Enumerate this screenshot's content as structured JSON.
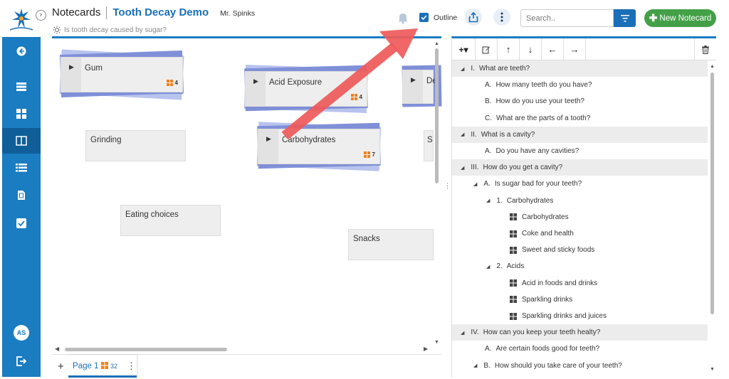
{
  "header": {
    "app_name": "Notecards",
    "project_name": "Tooth Decay Demo",
    "teacher": "Mr. Spinks",
    "question": "Is tooth decay caused by sugar?",
    "outline_label": "Outline",
    "outline_checked": true,
    "search_placeholder": "Search..",
    "new_button_label": "New Notecard"
  },
  "sidebar": {
    "items": [
      {
        "icon": "back-arrow-icon"
      },
      {
        "icon": "stack-icon"
      },
      {
        "icon": "grid-icon"
      },
      {
        "icon": "columns-icon",
        "active": true
      },
      {
        "icon": "list-icon"
      },
      {
        "icon": "document-icon"
      },
      {
        "icon": "checkbox-icon"
      }
    ],
    "avatar_initials": "AS",
    "logout_icon": "logout-icon"
  },
  "cards": [
    {
      "title": "Gum",
      "stacked": true,
      "count": "4"
    },
    {
      "title": "Acid Exposure",
      "stacked": true,
      "count": "4"
    },
    {
      "title": "De",
      "stacked": true,
      "count": ""
    },
    {
      "title": "Grinding",
      "stacked": false
    },
    {
      "title": "Carbohydrates",
      "stacked": true,
      "count": "7"
    },
    {
      "title": "S",
      "stacked": false
    },
    {
      "title": "Eating choices",
      "stacked": false
    },
    {
      "title": "Snacks",
      "stacked": false
    }
  ],
  "page_bar": {
    "add_label": "+",
    "page_name": "Page 1",
    "page_count": "32",
    "menu_label": "⋮"
  },
  "outline": {
    "toolbar": [
      "+▾",
      "edit-icon",
      "↑",
      "↓",
      "←",
      "→"
    ],
    "rows": [
      {
        "label": "I.",
        "text": "What are teeth?",
        "level": 0,
        "shaded": true,
        "expand": true
      },
      {
        "label": "A.",
        "text": "How many teeth do you have?",
        "level": 1
      },
      {
        "label": "B.",
        "text": "How do you use your teeth?",
        "level": 1
      },
      {
        "label": "C.",
        "text": "What are the parts of a tooth?",
        "level": 1
      },
      {
        "label": "II.",
        "text": "What is a cavity?",
        "level": 0,
        "shaded": true,
        "expand": true
      },
      {
        "label": "A.",
        "text": "Do you have any cavities?",
        "level": 1
      },
      {
        "label": "III.",
        "text": "How do you get a cavity?",
        "level": 0,
        "shaded": true,
        "expand": true
      },
      {
        "label": "A.",
        "text": "Is sugar bad for your teeth?",
        "level": 1,
        "expand": true
      },
      {
        "label": "1.",
        "text": "Carbohydrates",
        "level": 2,
        "expand": true
      },
      {
        "label": "",
        "text": "Carbohydrates",
        "level": 3,
        "notecard": true
      },
      {
        "label": "",
        "text": "Coke and health",
        "level": 3,
        "notecard": true
      },
      {
        "label": "",
        "text": "Sweet and sticky foods",
        "level": 3,
        "notecard": true
      },
      {
        "label": "2.",
        "text": "Acids",
        "level": 2,
        "expand": true
      },
      {
        "label": "",
        "text": "Acid in foods and drinks",
        "level": 3,
        "notecard": true
      },
      {
        "label": "",
        "text": "Sparkling drinks",
        "level": 3,
        "notecard": true
      },
      {
        "label": "",
        "text": "Sparkling drinks and juices",
        "level": 3,
        "notecard": true
      },
      {
        "label": "IV.",
        "text": "How can you keep your teeth healty?",
        "level": 0,
        "shaded": true,
        "expand": true
      },
      {
        "label": "A.",
        "text": "Are certain foods good for teeth?",
        "level": 1
      },
      {
        "label": "B.",
        "text": "How should you take care of your teeth?",
        "level": 1,
        "expand": true
      }
    ]
  },
  "colors": {
    "brand_blue": "#1a7cc1",
    "title_blue": "#1a6fb8",
    "new_button_green": "#43a047",
    "annotation_arrow": "#ef5a5a",
    "badge_orange": "#f0801e"
  }
}
